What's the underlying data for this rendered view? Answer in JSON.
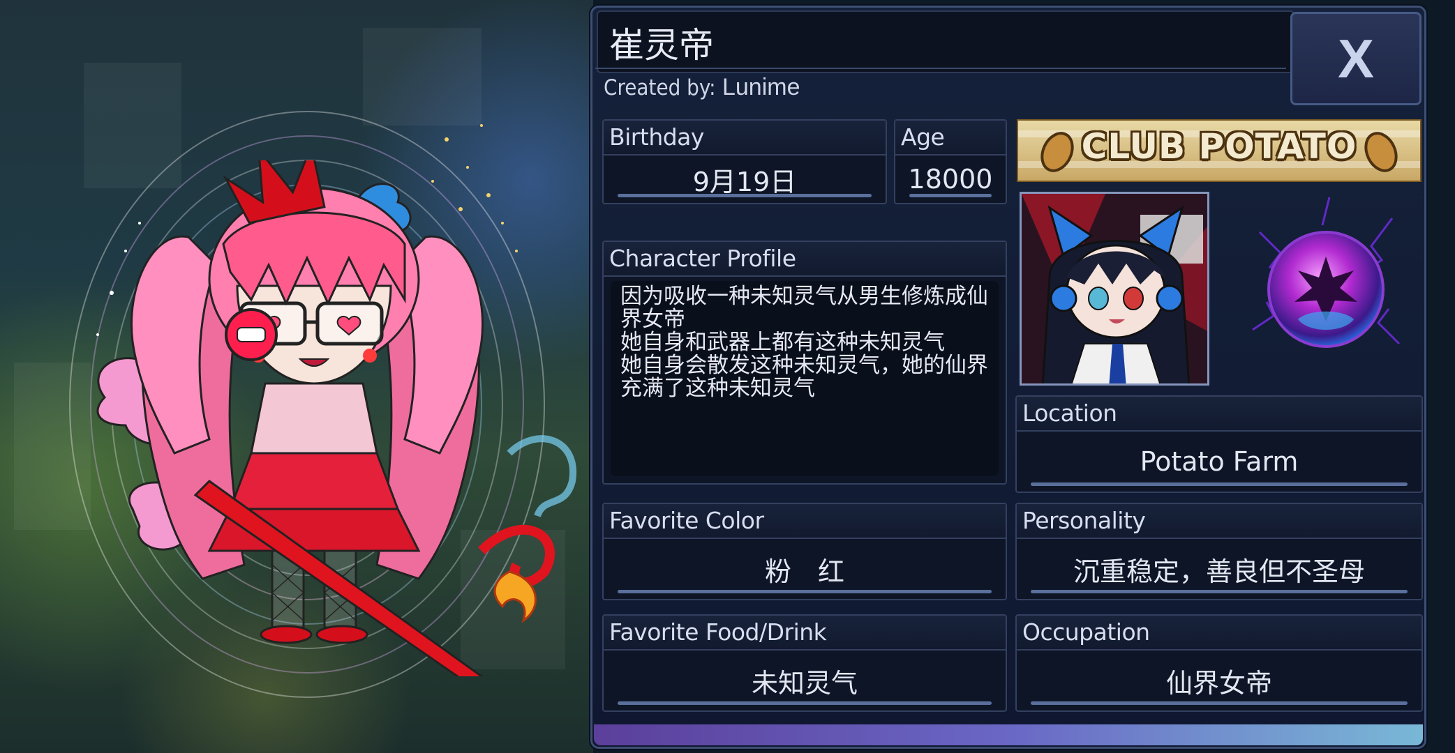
{
  "profile": {
    "name": "崔灵帝",
    "created_by_label": "Created by:",
    "created_by_value": "Lunime",
    "close_label": "X"
  },
  "fields": {
    "birthday": {
      "label": "Birthday",
      "value": "9月19日"
    },
    "age": {
      "label": "Age",
      "value": "18000"
    },
    "character_profile": {
      "label": "Character Profile",
      "text": "因为吸收一种未知灵气从男生修炼成仙界女帝\n她自身和武器上都有这种未知灵气\n她自身会散发这种未知灵气，她的仙界充满了这种未知灵气"
    },
    "location": {
      "label": "Location",
      "value": "Potato Farm"
    },
    "favorite_color": {
      "label": "Favorite Color",
      "value": "粉　红"
    },
    "personality": {
      "label": "Personality",
      "value": "沉重稳定，善良但不圣母"
    },
    "favorite_food": {
      "label": "Favorite Food/Drink",
      "value": "未知灵气"
    },
    "occupation": {
      "label": "Occupation",
      "value": "仙界女帝"
    }
  },
  "banner": {
    "text": "CLUB POTATO"
  },
  "icons": {
    "close": "close-icon",
    "avatar": "avatar-portrait",
    "orb": "element-orb-icon",
    "potato": "potato-icon"
  },
  "colors": {
    "panel_bg": "#15213a",
    "box_bg": "#0e1526",
    "border": "#34405f",
    "accent_gradient": [
      "#5b3f9b",
      "#79b8d6"
    ],
    "banner_gold": "#c9a866"
  }
}
